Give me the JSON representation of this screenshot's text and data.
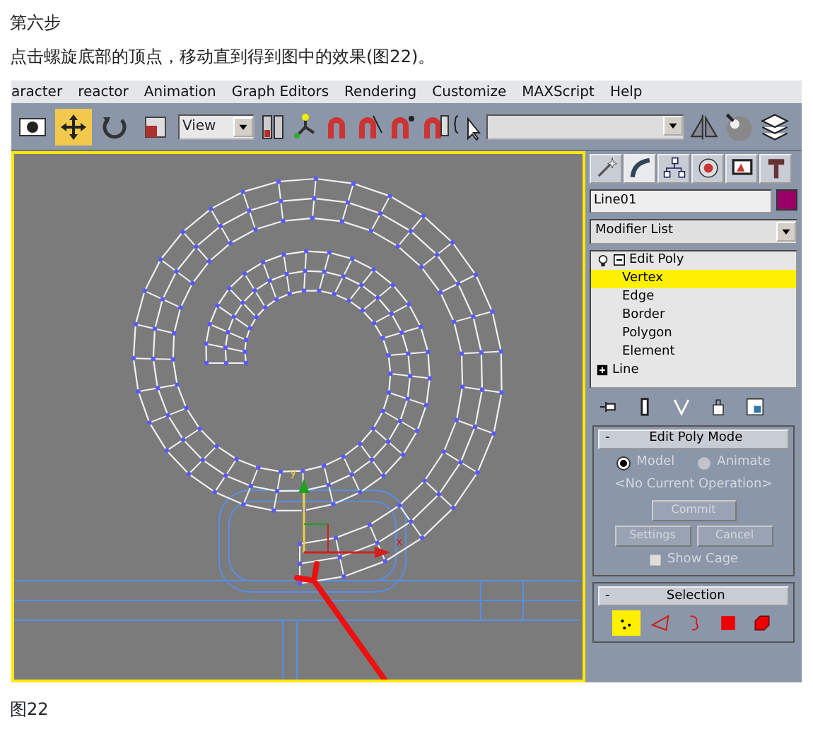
{
  "heading": "第六步",
  "instruction": "点击螺旋底部的顶点，移动直到得到图中的效果(图22)。",
  "app": {
    "menu": [
      "aracter",
      "reactor",
      "Animation",
      "Graph Editors",
      "Rendering",
      "Customize",
      "MAXScript",
      "Help"
    ],
    "toolbar": {
      "tools": [
        {
          "selected": false
        },
        {
          "selected": true
        },
        {
          "selected": false
        },
        {
          "selected": false
        }
      ],
      "coord_dropdown": "View"
    },
    "viewport": {
      "gizmo_labels": [
        "y",
        "x"
      ]
    },
    "command_panel": {
      "tabs": [
        {
          "selected": false
        },
        {
          "selected": true
        },
        {
          "selected": false
        },
        {
          "selected": false
        },
        {
          "selected": false
        },
        {
          "selected": false
        }
      ],
      "object_name": "Line01",
      "modifier_list": "Modifier List",
      "stack": [
        {
          "label": "Edit Poly",
          "expanded": true,
          "selected": false,
          "children": [
            {
              "label": "Vertex",
              "selected": true
            },
            {
              "label": "Edge",
              "selected": false
            },
            {
              "label": "Border",
              "selected": false
            },
            {
              "label": "Polygon",
              "selected": false
            },
            {
              "label": "Element",
              "selected": false
            }
          ]
        },
        {
          "label": "Line",
          "expanded": false,
          "selected": false
        }
      ],
      "rollouts": [
        {
          "title": "Edit Poly Mode",
          "toggle": "-",
          "kind": "mode",
          "radios": [
            {
              "label": "Model",
              "selected": true
            },
            {
              "label": "Animate",
              "selected": false
            }
          ],
          "status": "<No Current Operation>",
          "buttons": [
            {
              "label": "Commit",
              "disabled": true
            },
            {
              "label": "Settings",
              "disabled": true
            },
            {
              "label": "Cancel",
              "disabled": true
            }
          ],
          "checkbox": {
            "label": "Show Cage",
            "checked": false,
            "disabled": true
          }
        },
        {
          "title": "Selection",
          "toggle": "-",
          "kind": "selection",
          "levels": [
            {
              "selected": true
            },
            {
              "selected": false
            },
            {
              "selected": false
            },
            {
              "selected": false
            },
            {
              "selected": false
            }
          ]
        }
      ]
    }
  },
  "caption": "图22"
}
